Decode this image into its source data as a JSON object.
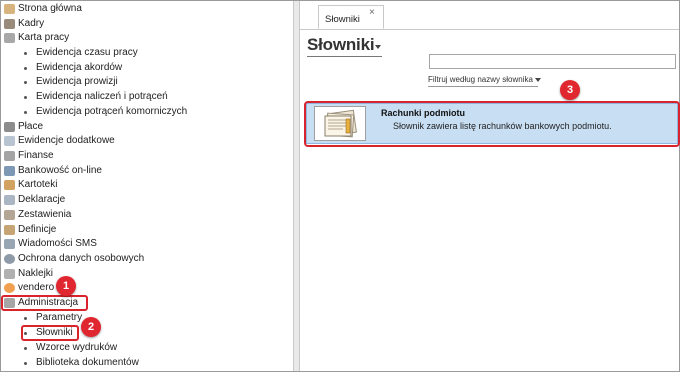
{
  "nav": {
    "items": [
      {
        "label": "Strona główna",
        "icon": "home-icon",
        "color": "#b07a3c"
      },
      {
        "label": "Kadry",
        "icon": "people-icon",
        "color": "#7a6a5a"
      },
      {
        "label": "Karta pracy",
        "icon": "timecard-icon",
        "color": "#8a8a8a"
      },
      {
        "label": "Płace",
        "icon": "wallet-icon",
        "color": "#777777"
      },
      {
        "label": "Ewidencje dodatkowe",
        "icon": "folder-icon",
        "color": "#9aa7b8"
      },
      {
        "label": "Finanse",
        "icon": "finance-icon",
        "color": "#8a8a8a"
      },
      {
        "label": "Bankowość on-line",
        "icon": "bank-icon",
        "color": "#5a7a9a"
      },
      {
        "label": "Kartoteki",
        "icon": "cards-icon",
        "color": "#c08a3a"
      },
      {
        "label": "Deklaracje",
        "icon": "declaration-icon",
        "color": "#8a9aaa"
      },
      {
        "label": "Zestawienia",
        "icon": "report-icon",
        "color": "#9a8a7a"
      },
      {
        "label": "Definicje",
        "icon": "definitions-icon",
        "color": "#aa8a5a"
      },
      {
        "label": "Wiadomości SMS",
        "icon": "sms-icon",
        "color": "#7a8a9a"
      },
      {
        "label": "Ochrona danych osobowych",
        "icon": "shield-icon",
        "color": "#6a7a8a"
      },
      {
        "label": "Naklejki",
        "icon": "sticker-icon",
        "color": "#9a9a9a"
      },
      {
        "label": "vendero",
        "icon": "vendero-icon",
        "color": "#e07a20"
      },
      {
        "label": "Administracja",
        "icon": "admin-icon",
        "color": "#8a8a8a"
      }
    ],
    "karta_sub": [
      "Ewidencja czasu pracy",
      "Ewidencja akordów",
      "Ewidencja prowizji",
      "Ewidencja naliczeń i potrąceń",
      "Ewidencja potrąceń komorniczych"
    ],
    "admin_sub": [
      "Parametry",
      "Słowniki",
      "Wzorce wydruków",
      "Biblioteka dokumentów"
    ]
  },
  "badges": [
    "1",
    "2",
    "3"
  ],
  "tab": {
    "label": "Słowniki",
    "close": "×"
  },
  "page": {
    "title": "Słowniki",
    "search_value": "",
    "filter_label": "Filtruj według nazwy słownika"
  },
  "card": {
    "title": "Rachunki podmiotu",
    "description": "Słownik zawiera listę rachunków bankowych podmiotu."
  },
  "colors": {
    "highlight": "#d9232d",
    "selection": "#c8def3",
    "badge": "#e0262f"
  }
}
